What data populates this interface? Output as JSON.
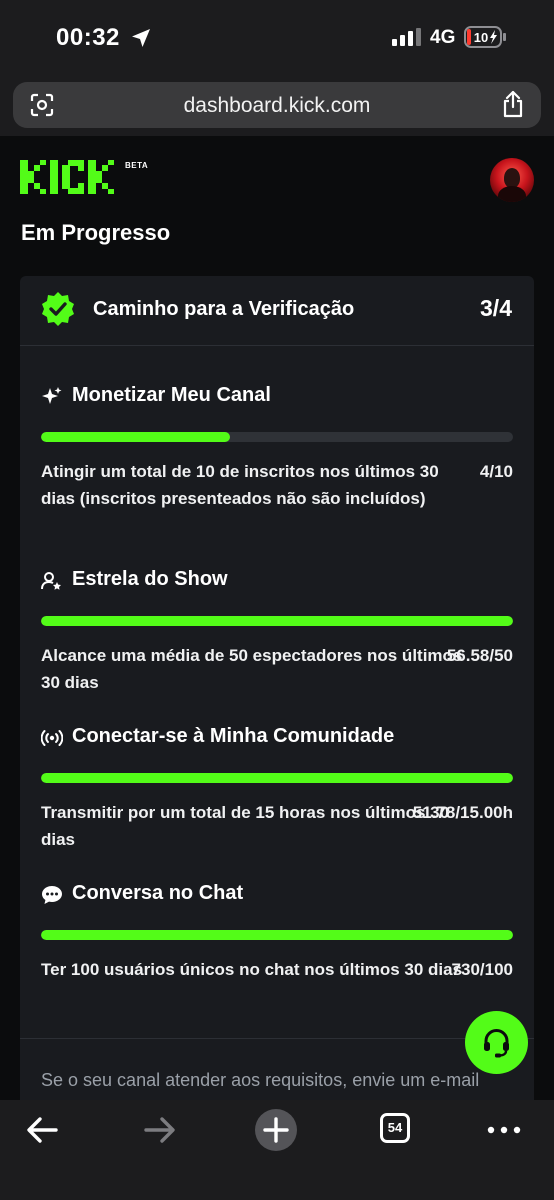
{
  "status_bar": {
    "time": "00:32",
    "network": "4G",
    "battery": "10"
  },
  "browser": {
    "url": "dashboard.kick.com"
  },
  "header": {
    "logo_text": "KICK",
    "beta_label": "BETA",
    "page_title": "Em Progresso"
  },
  "card": {
    "title": "Caminho para a Verificação",
    "count": "3/4",
    "sections": [
      {
        "icon": "sparkles-icon",
        "title": "Monetizar Meu Canal",
        "requirement": "Atingir um total de 10 de inscritos nos últimos 30 dias (inscritos presenteados não são incluídos)",
        "value": "4/10",
        "progress": 0.4
      },
      {
        "icon": "user-star-icon",
        "title": "Estrela do Show",
        "requirement": "Alcance uma média de 50 espectadores nos últimos 30 dias",
        "value": "56.58/50",
        "progress": 1.0
      },
      {
        "icon": "broadcast-icon",
        "title": "Conectar-se à Minha Comunidade",
        "requirement": "Transmitir por um total de 15 horas nos últimos 30 dias",
        "value": "51.78/15.00h",
        "progress": 1.0
      },
      {
        "icon": "chat-bubble-icon",
        "title": "Conversa no Chat",
        "requirement": "Ter 100 usuários únicos no chat nos últimos 30 dias",
        "value": "730/100",
        "progress": 1.0
      }
    ],
    "footer_note": "Se o seu canal atender aos requisitos, envie um e-mail"
  },
  "toolbar": {
    "tabs_count": "54"
  },
  "colors": {
    "accent": "#53fc18",
    "track": "#2f3237",
    "card_bg": "#191b1f",
    "page_bg": "#0b0c0d"
  }
}
